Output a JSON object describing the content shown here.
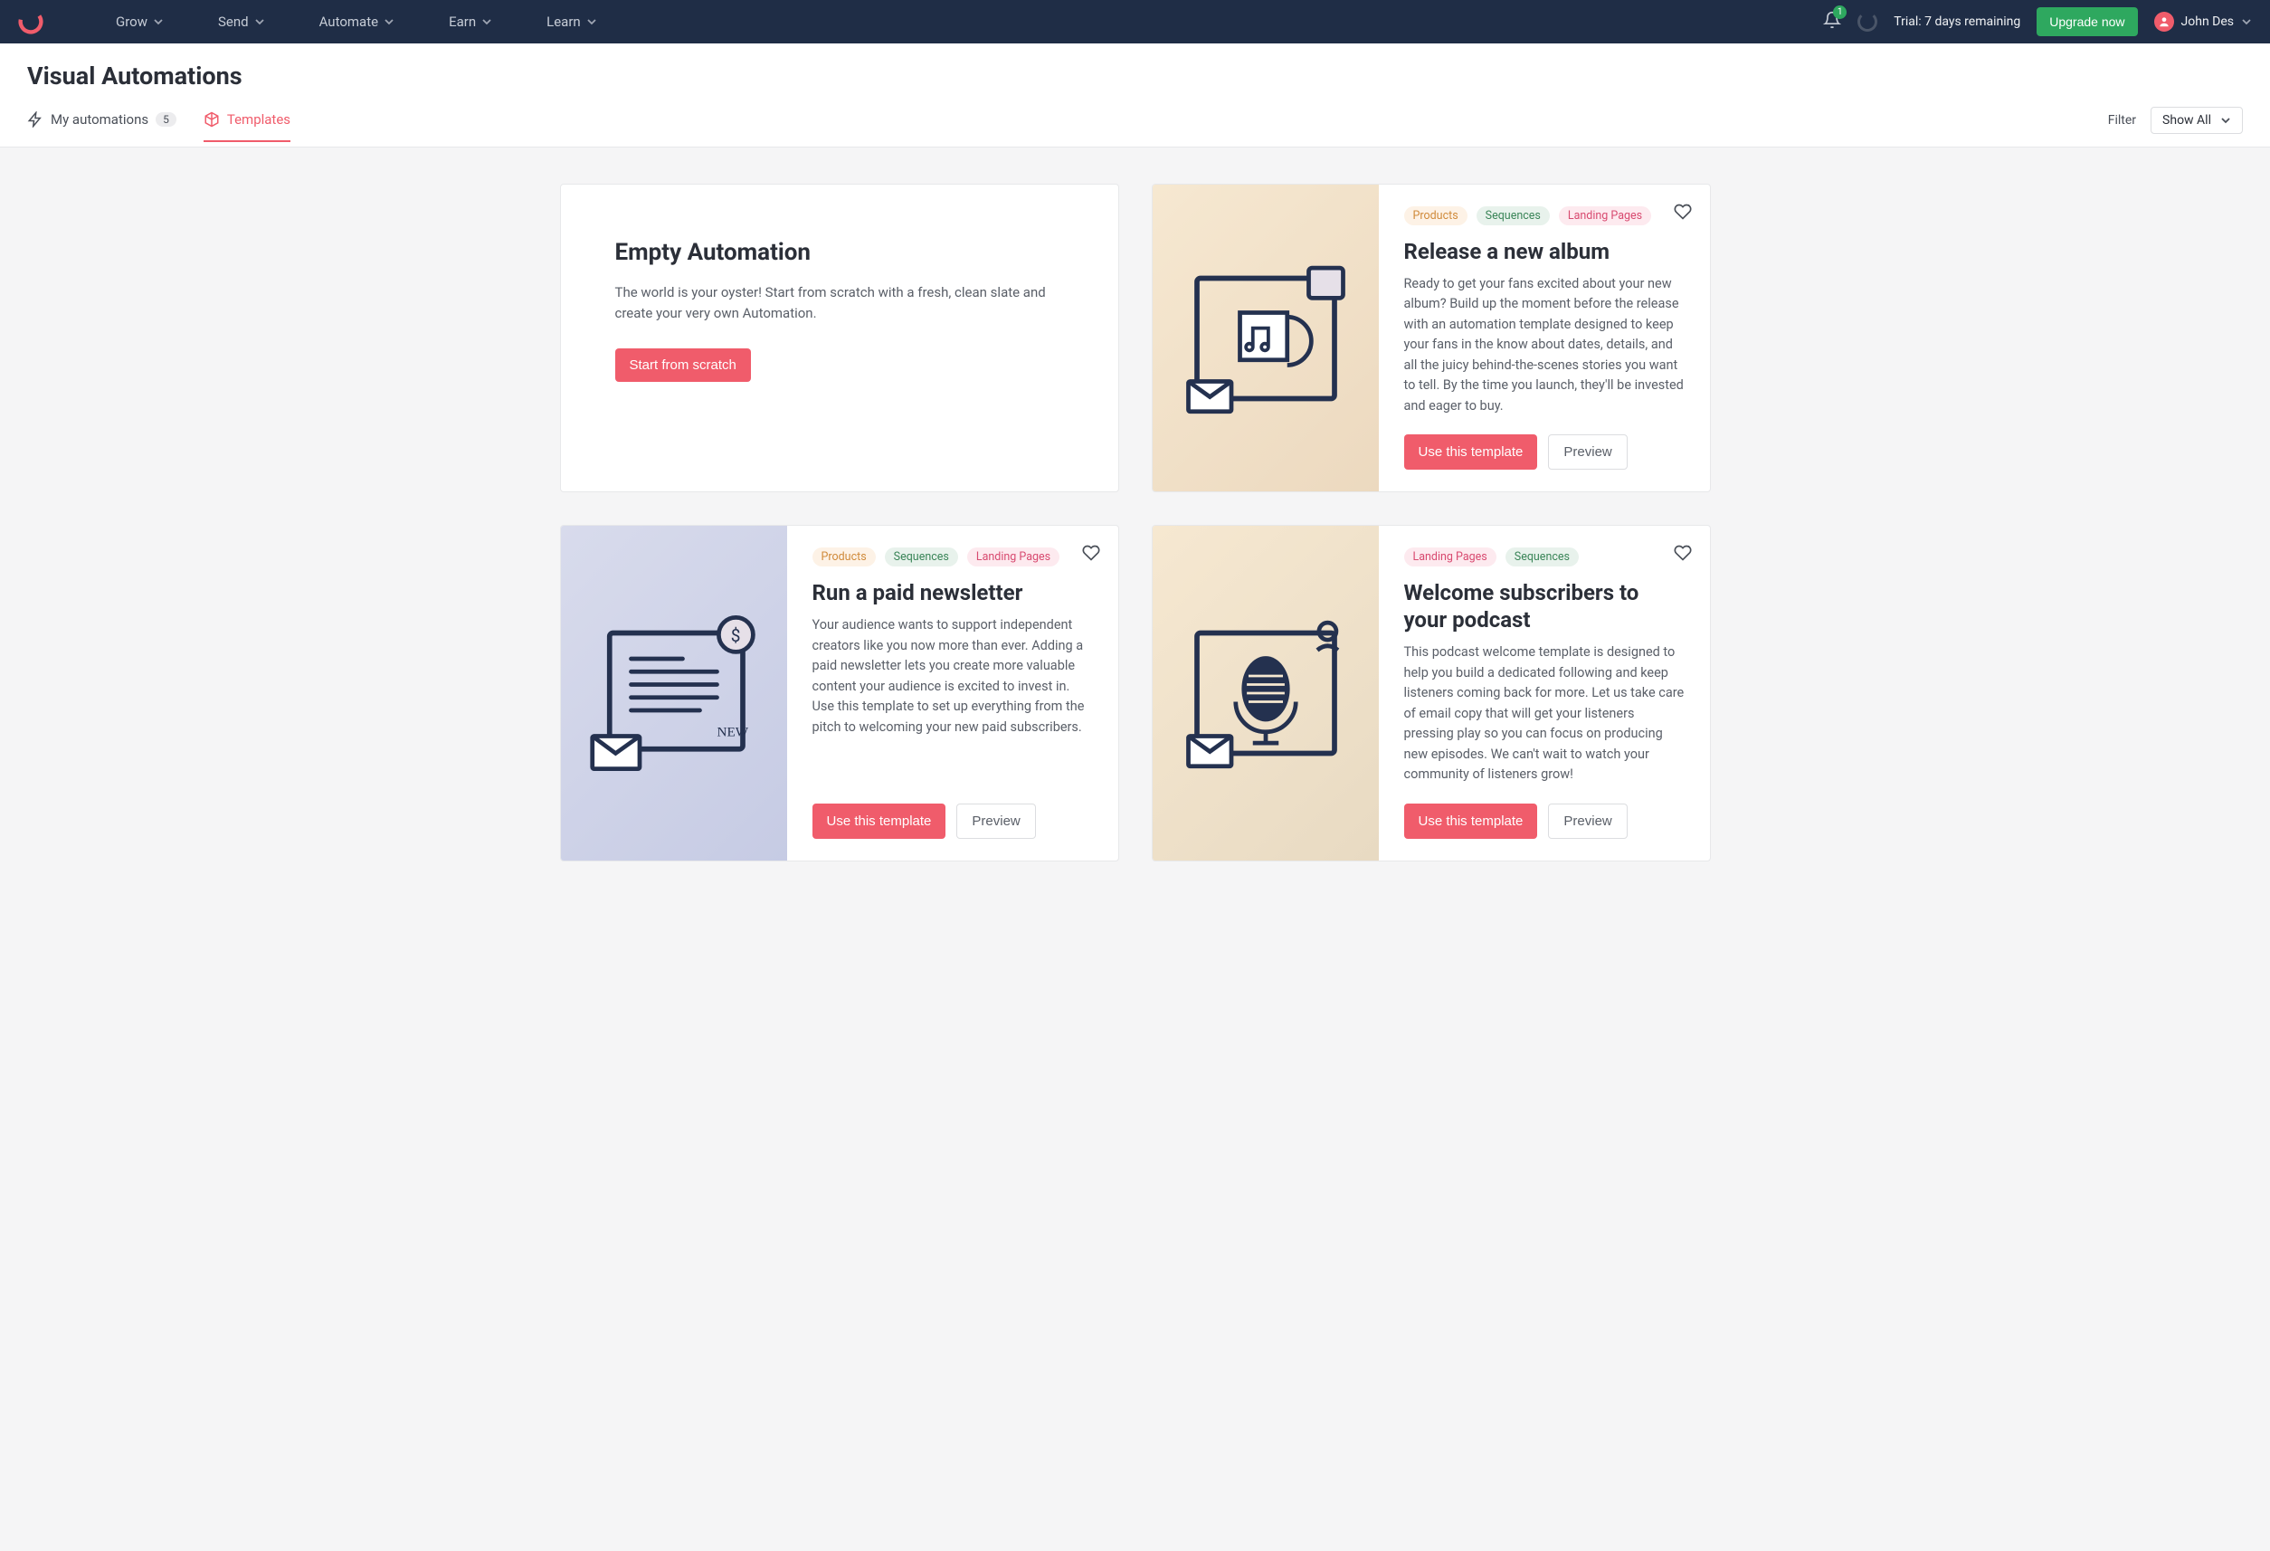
{
  "nav": {
    "items": [
      "Grow",
      "Send",
      "Automate",
      "Earn",
      "Learn"
    ],
    "trial": "Trial: 7 days remaining",
    "upgrade": "Upgrade now",
    "user": "John Des",
    "notification_count": "1"
  },
  "page": {
    "title": "Visual Automations"
  },
  "tabs": {
    "my_automations": {
      "label": "My automations",
      "count": "5"
    },
    "templates": {
      "label": "Templates"
    }
  },
  "filter": {
    "label": "Filter",
    "selected": "Show All"
  },
  "buttons": {
    "use_template": "Use this template",
    "preview": "Preview",
    "start_scratch": "Start from scratch"
  },
  "tag_labels": {
    "products": "Products",
    "sequences": "Sequences",
    "landing_pages": "Landing Pages"
  },
  "cards": {
    "empty": {
      "title": "Empty Automation",
      "desc": "The world is your oyster! Start from scratch with a fresh, clean slate and create your very own Automation."
    },
    "album": {
      "title": "Release a new album",
      "desc": "Ready to get your fans excited about your new album? Build up the moment before the release with an automation template designed to keep your fans in the know about dates, details, and all the juicy behind-the-scenes stories you want to tell. By the time you launch, they'll be invested and eager to buy."
    },
    "newsletter": {
      "title": "Run a paid newsletter",
      "desc": "Your audience wants to support independent creators like you now more than ever. Adding a paid newsletter lets you create more valuable content your audience is excited to invest in. Use this template to set up everything from the pitch to welcoming your new paid subscribers."
    },
    "podcast": {
      "title": "Welcome subscribers to your podcast",
      "desc": "This podcast welcome template is designed to help you build a dedicated following and keep listeners coming back for more. Let us take care of email copy that will get your listeners pressing play so you can focus on producing new episodes. We can't wait to watch your community of listeners grow!"
    }
  }
}
